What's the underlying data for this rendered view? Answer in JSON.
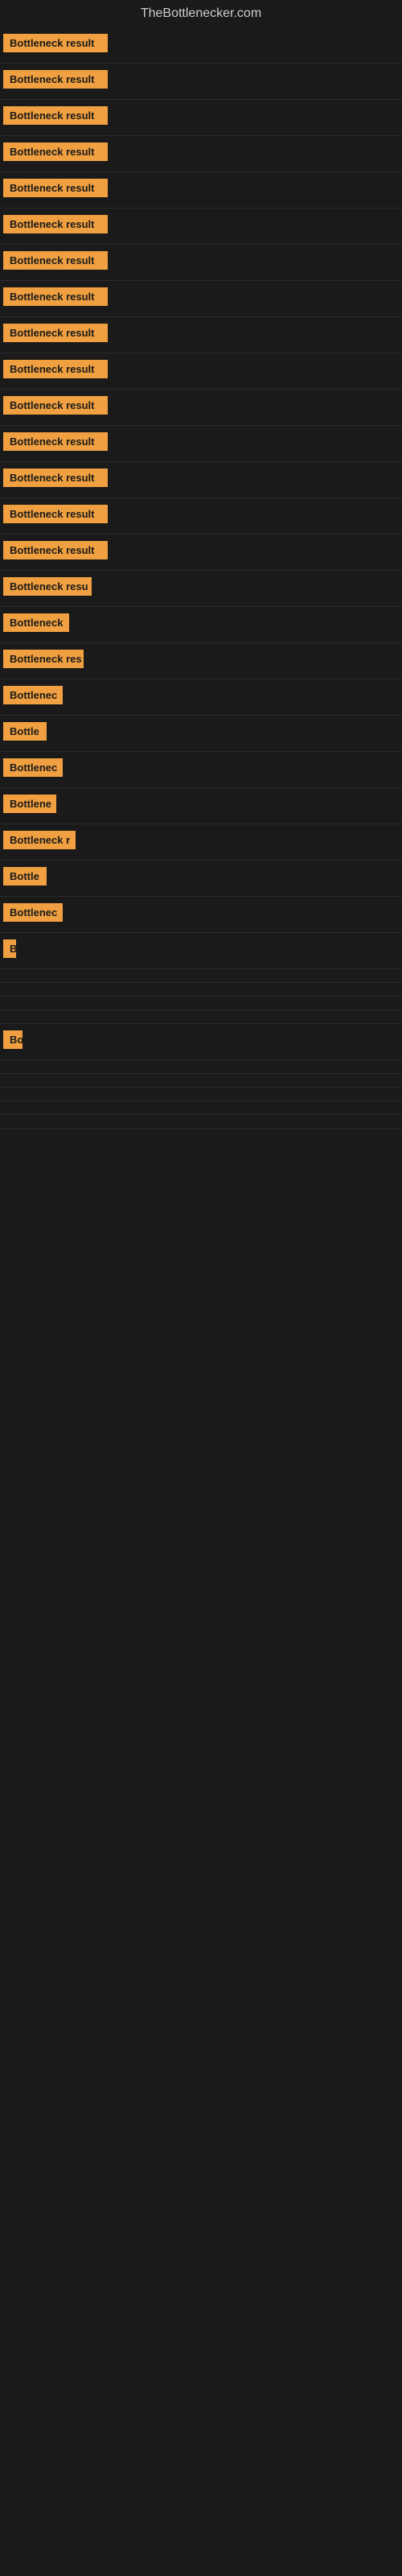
{
  "site": {
    "title": "TheBottlenecker.com"
  },
  "rows": [
    {
      "id": 1,
      "label": "Bottleneck result",
      "width": 130
    },
    {
      "id": 2,
      "label": "Bottleneck result",
      "width": 130
    },
    {
      "id": 3,
      "label": "Bottleneck result",
      "width": 130
    },
    {
      "id": 4,
      "label": "Bottleneck result",
      "width": 130
    },
    {
      "id": 5,
      "label": "Bottleneck result",
      "width": 130
    },
    {
      "id": 6,
      "label": "Bottleneck result",
      "width": 130
    },
    {
      "id": 7,
      "label": "Bottleneck result",
      "width": 130
    },
    {
      "id": 8,
      "label": "Bottleneck result",
      "width": 130
    },
    {
      "id": 9,
      "label": "Bottleneck result",
      "width": 130
    },
    {
      "id": 10,
      "label": "Bottleneck result",
      "width": 130
    },
    {
      "id": 11,
      "label": "Bottleneck result",
      "width": 130
    },
    {
      "id": 12,
      "label": "Bottleneck result",
      "width": 130
    },
    {
      "id": 13,
      "label": "Bottleneck result",
      "width": 130
    },
    {
      "id": 14,
      "label": "Bottleneck result",
      "width": 130
    },
    {
      "id": 15,
      "label": "Bottleneck result",
      "width": 130
    },
    {
      "id": 16,
      "label": "Bottleneck resu",
      "width": 110
    },
    {
      "id": 17,
      "label": "Bottleneck",
      "width": 82
    },
    {
      "id": 18,
      "label": "Bottleneck res",
      "width": 100
    },
    {
      "id": 19,
      "label": "Bottlenec",
      "width": 74
    },
    {
      "id": 20,
      "label": "Bottle",
      "width": 54
    },
    {
      "id": 21,
      "label": "Bottlenec",
      "width": 74
    },
    {
      "id": 22,
      "label": "Bottlene",
      "width": 66
    },
    {
      "id": 23,
      "label": "Bottleneck r",
      "width": 90
    },
    {
      "id": 24,
      "label": "Bottle",
      "width": 54
    },
    {
      "id": 25,
      "label": "Bottlenec",
      "width": 74
    },
    {
      "id": 26,
      "label": "B",
      "width": 16
    },
    {
      "id": 27,
      "label": "",
      "width": 0
    },
    {
      "id": 28,
      "label": "",
      "width": 0
    },
    {
      "id": 29,
      "label": "",
      "width": 0
    },
    {
      "id": 30,
      "label": "",
      "width": 0
    },
    {
      "id": 31,
      "label": "Bo",
      "width": 24
    },
    {
      "id": 32,
      "label": "",
      "width": 0
    },
    {
      "id": 33,
      "label": "",
      "width": 0
    },
    {
      "id": 34,
      "label": "",
      "width": 0
    },
    {
      "id": 35,
      "label": "",
      "width": 0
    },
    {
      "id": 36,
      "label": "",
      "width": 0
    }
  ],
  "colors": {
    "bar_bg": "#f0a040",
    "bar_text": "#1a1a1a",
    "page_bg": "#1a1a1a",
    "title_text": "#cccccc"
  }
}
